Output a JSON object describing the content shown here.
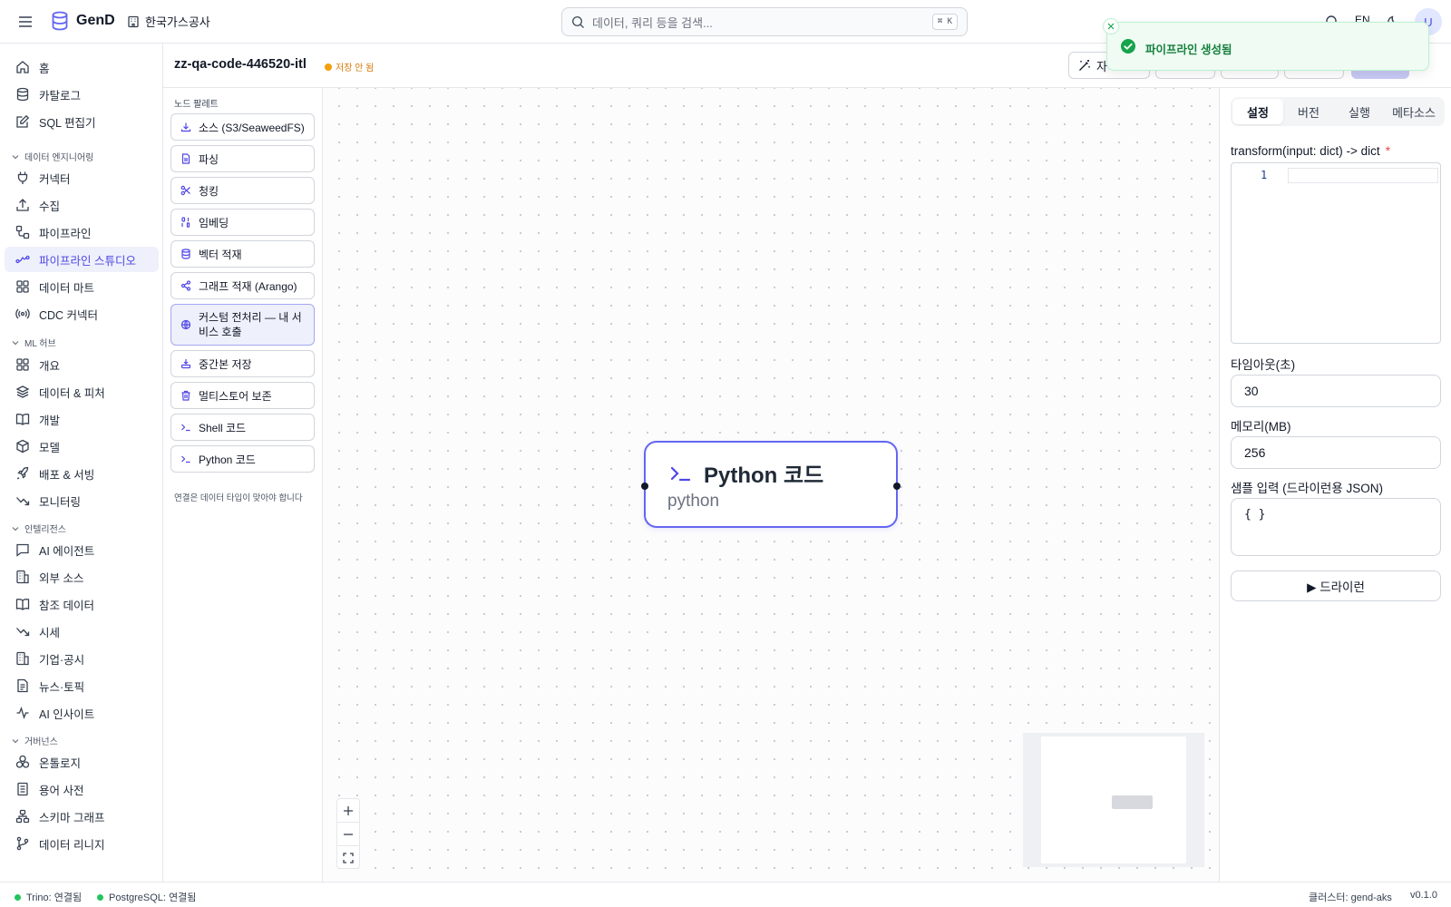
{
  "app": {
    "brand": "GenD",
    "org": "한국가스공사"
  },
  "header": {
    "search_placeholder": "데이터, 쿼리 등을 검색...",
    "shortcut": "⌘ K",
    "lang": "EN",
    "avatar_initial": "U"
  },
  "sidebar": {
    "top": [
      "홈",
      "카탈로그",
      "SQL 편집기"
    ],
    "sections": [
      {
        "title": "데이터 엔지니어링",
        "items": [
          "커넥터",
          "수집",
          "파이프라인",
          "파이프라인 스튜디오",
          "데이터 마트",
          "CDC 커넥터"
        ]
      },
      {
        "title": "ML 허브",
        "items": [
          "개요",
          "데이터 & 피처",
          "개발",
          "모델",
          "배포 & 서빙",
          "모니터링"
        ]
      },
      {
        "title": "인텔리전스",
        "items": [
          "AI 에이전트",
          "외부 소스",
          "참조 데이터",
          "시세",
          "기업·공시",
          "뉴스·토픽",
          "AI 인사이트"
        ]
      },
      {
        "title": "거버넌스",
        "items": [
          "온톨로지",
          "용어 사전",
          "스키마 그래프",
          "데이터 리니지"
        ]
      }
    ],
    "active": "파이프라인 스튜디오"
  },
  "pipeline": {
    "name": "zz-qa-code-446520-itl",
    "status": "저장 안 됨",
    "toolbar_first_label": "자"
  },
  "palette": {
    "title": "노드 팔레트",
    "items": [
      {
        "label": "소스 (S3/SeaweedFS)",
        "icon": "download-icon"
      },
      {
        "label": "파싱",
        "icon": "file-icon"
      },
      {
        "label": "청킹",
        "icon": "scissors-icon"
      },
      {
        "label": "임베딩",
        "icon": "binary-icon"
      },
      {
        "label": "벡터 적재",
        "icon": "database-icon"
      },
      {
        "label": "그래프 적재 (Arango)",
        "icon": "share-icon"
      },
      {
        "label": "커스텀 전처리 — 내 서비스 호출",
        "icon": "globe-icon"
      },
      {
        "label": "중간본 저장",
        "icon": "hard-drive-download-icon"
      },
      {
        "label": "멀티스토어 보존",
        "icon": "trash-icon"
      },
      {
        "label": "Shell 코드",
        "icon": "terminal-icon"
      },
      {
        "label": "Python 코드",
        "icon": "terminal-icon"
      }
    ],
    "footer": "연결은 데이터 타입이 맞아야 합니다"
  },
  "node": {
    "title": "Python 코드",
    "subtitle": "python",
    "icon": "terminal-icon"
  },
  "inspector": {
    "tabs": [
      "설정",
      "버전",
      "실행",
      "메타소스"
    ],
    "active_tab": "설정",
    "code_label": "transform(input: dict) -> dict",
    "code_required": "*",
    "line_number": "1",
    "timeout_label": "타임아웃(초)",
    "timeout_value": "30",
    "memory_label": "메모리(MB)",
    "memory_value": "256",
    "sample_label": "샘플 입력 (드라이런용 JSON)",
    "sample_value": "{ }",
    "dryrun_label": "▶ 드라이런"
  },
  "toast": {
    "message": "파이프라인 생성됨"
  },
  "statusbar": {
    "trino": "Trino: 연결됨",
    "postgres": "PostgreSQL: 연결됨",
    "cluster": "클러스터: gend-aks",
    "version": "v0.1.0"
  },
  "colors": {
    "accent": "#4f46e5",
    "success": "#16a34a",
    "warning": "#f59e0b"
  }
}
